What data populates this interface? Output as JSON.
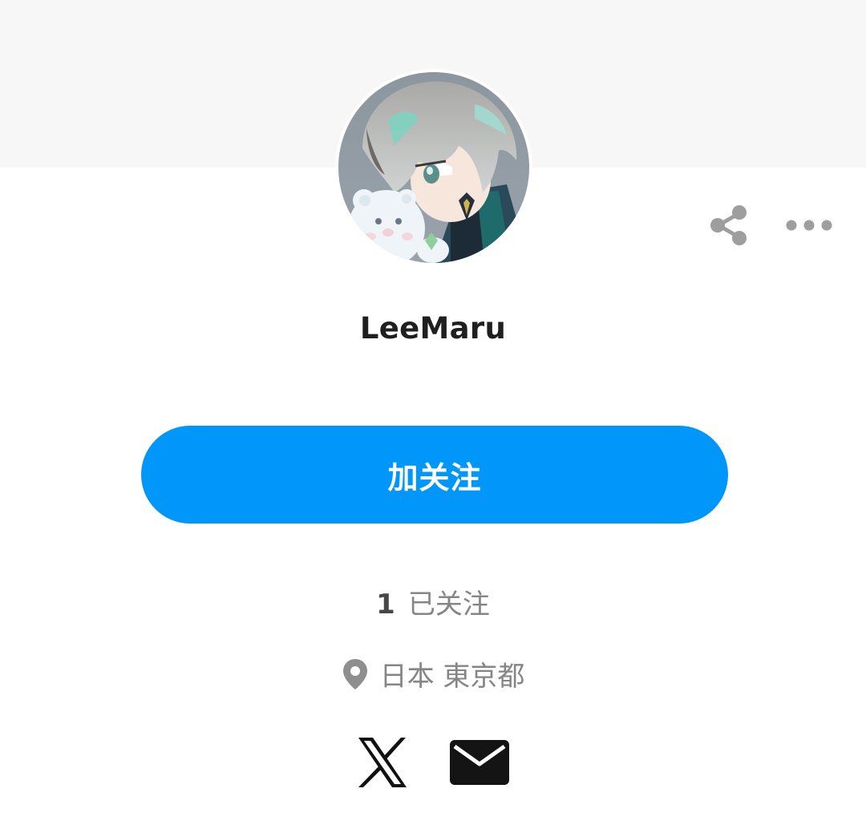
{
  "profile": {
    "username": "LeeMaru",
    "follow_button_label": "加关注",
    "following_count": "1",
    "following_label": "已关注",
    "location": "日本 東京都"
  },
  "icons": {
    "share": "share-icon",
    "more": "more-horizontal-icon",
    "location": "location-pin-icon",
    "x": "x-logo-icon",
    "mail": "mail-icon"
  },
  "colors": {
    "accent": "#0096fa",
    "cover_background": "#f7f7f7",
    "username_text": "#1f1f1f",
    "secondary_text": "#858585",
    "icon_gray": "#9e9e9e"
  }
}
